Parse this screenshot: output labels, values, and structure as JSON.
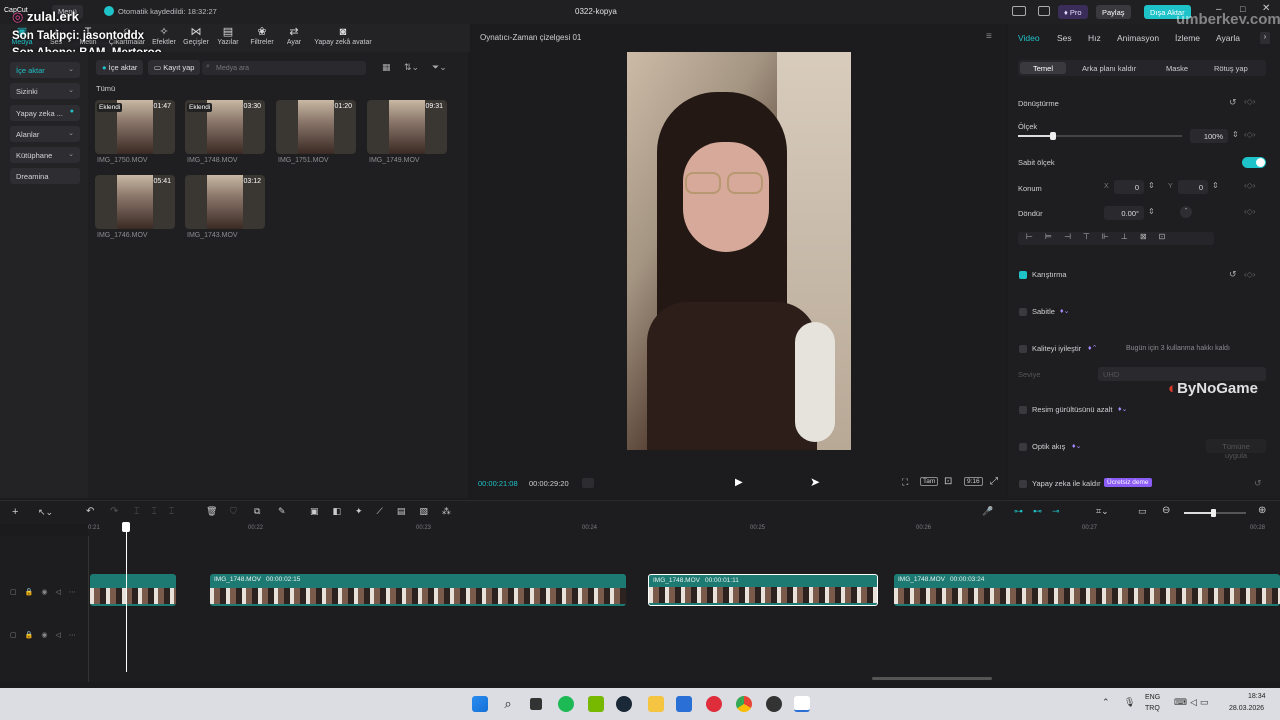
{
  "overlay": {
    "brand": "zulal.erk",
    "follower": "Son Takipçi: jasontoddx",
    "subscriber": "Son Abone: BAM_Mertoroo",
    "watermark_top": "umberkey.com.tr",
    "watermark_right": "ByNoGame"
  },
  "titlebar": {
    "app": "CapCut",
    "menu": "Menü",
    "autosave": "Otomatik kaydedildi: 18:32:27",
    "project": "0322-kopya",
    "pro": "Pro",
    "share": "Paylaş",
    "export": "Dışa Aktar"
  },
  "toolbar": [
    {
      "label": "Medya",
      "icon": "media-icon"
    },
    {
      "label": "Ses",
      "icon": "audio-icon"
    },
    {
      "label": "Metin",
      "icon": "text-icon"
    },
    {
      "label": "Çıkartmalar",
      "icon": "sticker-icon"
    },
    {
      "label": "Efektler",
      "icon": "effects-icon"
    },
    {
      "label": "Geçişler",
      "icon": "transitions-icon"
    },
    {
      "label": "Yazılar",
      "icon": "captions-icon"
    },
    {
      "label": "Filtreler",
      "icon": "filters-icon"
    },
    {
      "label": "Ayar",
      "icon": "adjust-icon"
    },
    {
      "label": "Yapay zekâ avatar",
      "icon": "ai-avatar-icon"
    }
  ],
  "leftnav": [
    "İçe aktar",
    "Sizinki",
    "Yapay zeka ...",
    "Alanlar",
    "Kütüphane",
    "Dreamina"
  ],
  "media": {
    "import": "İçe aktar",
    "record": "Kayıt yap",
    "search_placeholder": "Medya ara",
    "section": "Tümü",
    "items": [
      {
        "name": "IMG_1750.MOV",
        "dur": "01:47",
        "badge": "Eklendi"
      },
      {
        "name": "IMG_1748.MOV",
        "dur": "03:30",
        "badge": "Eklendi"
      },
      {
        "name": "IMG_1751.MOV",
        "dur": "01:20",
        "badge": ""
      },
      {
        "name": "IMG_1749.MOV",
        "dur": "09:31",
        "badge": ""
      },
      {
        "name": "IMG_1746.MOV",
        "dur": "05:41",
        "badge": ""
      },
      {
        "name": "IMG_1743.MOV",
        "dur": "03:12",
        "badge": ""
      }
    ]
  },
  "player": {
    "title": "Oynatıcı-Zaman çizelgesi 01",
    "current": "00:00:21:08",
    "total": "00:00:29:20",
    "full": "Tam",
    "ratio": "9:16"
  },
  "right": {
    "tabs": [
      "Video",
      "Ses",
      "Hız",
      "Animasyon",
      "İzleme",
      "Ayarla"
    ],
    "subtabs": [
      "Temel",
      "Arka planı kaldır",
      "Maske",
      "Rötuş yap"
    ],
    "transform": "Dönüştürme",
    "scale": "Ölçek",
    "scale_val": "100%",
    "uniform": "Sabit ölçek",
    "position": "Konum",
    "pos_x_label": "X",
    "pos_x": "0",
    "pos_y_label": "Y",
    "pos_y": "0",
    "rotate": "Döndür",
    "rotate_val": "0.00°",
    "rotate_dash": "-",
    "blend": "Karıştırma",
    "stabilize": "Sabitle",
    "enhance": "Kaliteyi iyileştir",
    "enhance_note": "Bugün için 3 kullanma hakkı kaldı",
    "level": "Seviye",
    "level_val": "UHD",
    "denoise": "Resim gürültüsünü azalt",
    "optical": "Optik akış",
    "apply_all": "Tümüne uygula",
    "ai_remove": "Yapay zeka ile kaldır",
    "free_trial": "Ücretsiz deme"
  },
  "timeline": {
    "ticks": [
      "0:21",
      "00:22",
      "00:23",
      "00:24",
      "00:25",
      "00:26",
      "00:27",
      "00:28"
    ],
    "clips": [
      {
        "name": "IMG_1748.MOV",
        "time": "00:00:02:15"
      },
      {
        "name": "IMG_1748.MOV",
        "time": "00:00:01:11"
      },
      {
        "name": "IMG_1748.MOV",
        "time": "00:00:03:24"
      }
    ]
  },
  "taskbar": {
    "lang1": "ENG",
    "lang2": "TRQ",
    "time": "18:34",
    "date": "28.03.2026"
  },
  "colors": {
    "accent": "#1ec3c9",
    "clip": "#1d7a72",
    "export": "#1ec3c9"
  }
}
